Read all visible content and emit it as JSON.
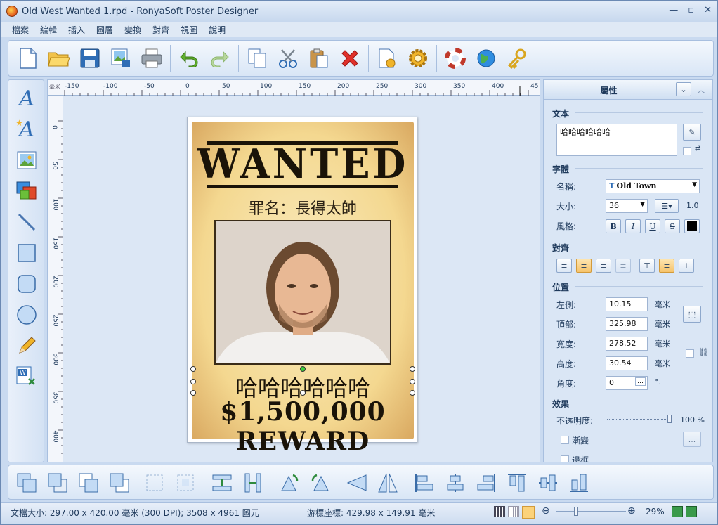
{
  "window": {
    "title": "Old West Wanted 1.rpd - RonyaSoft Poster Designer",
    "buttons": {
      "minimize": "—",
      "maximize": "▫",
      "close": "✕"
    }
  },
  "menu": [
    "檔案",
    "編輯",
    "插入",
    "圖層",
    "變換",
    "對齊",
    "視圖",
    "說明"
  ],
  "ruler": {
    "units_label": "毫米",
    "h_ticks": [
      "-150",
      "-100",
      "-50",
      "0",
      "50",
      "100",
      "150",
      "200",
      "250",
      "300",
      "350",
      "400",
      "45"
    ],
    "v_ticks": [
      "0",
      "50",
      "100",
      "150",
      "200",
      "250",
      "300",
      "350",
      "400"
    ]
  },
  "poster": {
    "headline": "WANTED",
    "crime": "罪名：長得太帥",
    "selected_text": "哈哈哈哈哈哈",
    "reward": "$1,500,000 REWARD"
  },
  "properties": {
    "header": "屬性",
    "text_section": "文本",
    "text_value": "哈哈哈哈哈哈",
    "font_section": "字體",
    "font_name_label": "名稱:",
    "font_name": "Old Town",
    "font_size_label": "大小:",
    "font_size": "36",
    "line_spacing": "1.0",
    "style_label": "風格:",
    "style_buttons": [
      "B",
      "I",
      "U",
      "S"
    ],
    "align_section": "對齊",
    "position_section": "位置",
    "left_label": "左側:",
    "left_value": "10.15",
    "top_label": "頂部:",
    "top_value": "325.98",
    "width_label": "寬度:",
    "width_value": "278.52",
    "height_label": "高度:",
    "height_value": "30.54",
    "angle_label": "角度:",
    "angle_value": "0",
    "angle_unit": "°.",
    "unit": "毫米",
    "effects_section": "效果",
    "opacity_label": "不透明度:",
    "opacity_value": "100 %",
    "gradient_label": "漸變",
    "border_label": "邊框",
    "more_button": "..."
  },
  "status": {
    "doc_size": "文檔大小: 297.00 x 420.00 毫米 (300 DPI); 3508 x 4961 圖元",
    "cursor": "游標座標: 429.98 x 149.91 毫米",
    "zoom": "29%"
  },
  "colors": {
    "accent": "#1e395b",
    "text_color_swatch": "#000000"
  }
}
